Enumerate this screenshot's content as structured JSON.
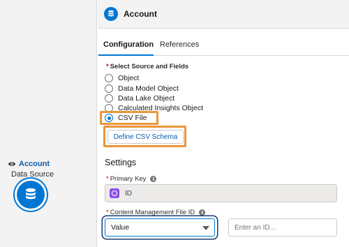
{
  "node": {
    "title": "Account",
    "subtitle": "Data Source",
    "icon": "database-icon",
    "eye_icon": "eye-icon"
  },
  "panel": {
    "title": "Account",
    "icon": "database-icon"
  },
  "tabs": [
    {
      "label": "Configuration",
      "active": true
    },
    {
      "label": "References",
      "active": false
    }
  ],
  "source": {
    "required_mark": "*",
    "label": "Select Source and Fields",
    "options": [
      {
        "label": "Object",
        "checked": false
      },
      {
        "label": "Data Model Object",
        "checked": false
      },
      {
        "label": "Data Lake Object",
        "checked": false
      },
      {
        "label": "Calculated Insights Object",
        "checked": false
      },
      {
        "label": "CSV File",
        "checked": true
      }
    ],
    "define_button": "Define CSV Schema"
  },
  "settings": {
    "heading": "Settings",
    "primary_key": {
      "required_mark": "*",
      "label": "Primary Key",
      "value": "ID",
      "info_icon": "info-icon"
    },
    "content_file": {
      "required_mark": "*",
      "label": "Content Management File ID",
      "select_value": "Value",
      "input_placeholder": "Enter an ID...",
      "info_icon": "info-icon"
    }
  },
  "colors": {
    "brand": "#0176d3",
    "highlight": "#e8963a",
    "required": "#ba0517",
    "pk_icon": "#9050e9"
  }
}
